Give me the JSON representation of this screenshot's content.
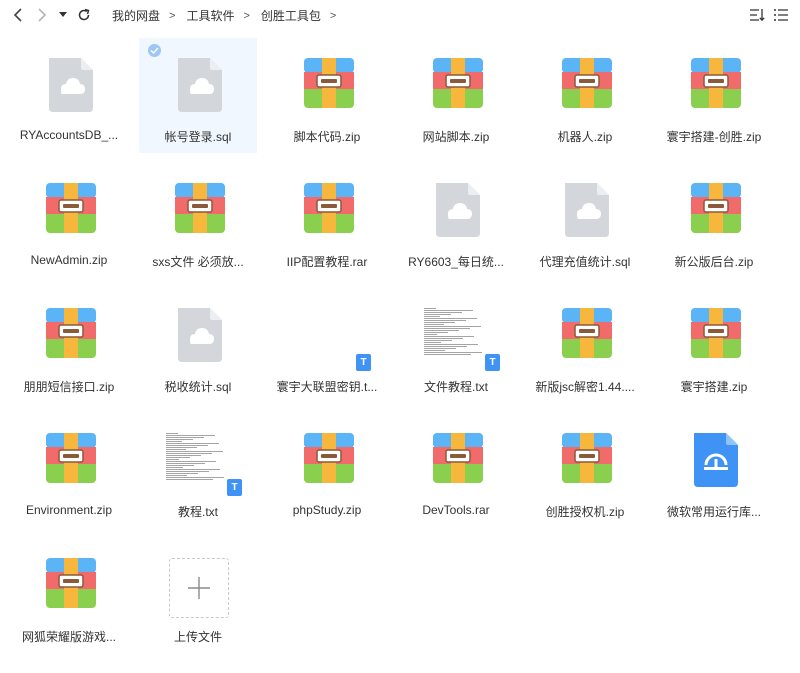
{
  "toolbar": {
    "back_icon": "chevron-left-icon",
    "forward_icon": "chevron-right-icon",
    "history_icon": "caret-down-icon",
    "refresh_icon": "refresh-icon",
    "sort_icon": "sort-icon",
    "list_view_icon": "list-view-icon"
  },
  "breadcrumb": {
    "items": [
      "我的网盘",
      "工具软件",
      "创胜工具包"
    ],
    "separator": ">"
  },
  "files": [
    {
      "name": "RYAccountsDB_...",
      "type": "doc"
    },
    {
      "name": "帐号登录.sql",
      "type": "doc",
      "selected": true
    },
    {
      "name": "脚本代码.zip",
      "type": "zip"
    },
    {
      "name": "网站脚本.zip",
      "type": "zip"
    },
    {
      "name": "机器人.zip",
      "type": "zip"
    },
    {
      "name": "寰宇搭建-创胜.zip",
      "type": "zip"
    },
    {
      "name": "NewAdmin.zip",
      "type": "zip"
    },
    {
      "name": "sxs文件 必须放...",
      "type": "zip"
    },
    {
      "name": "IIP配置教程.rar",
      "type": "zip"
    },
    {
      "name": "RY6603_每日统...",
      "type": "doc"
    },
    {
      "name": "代理充值统计.sql",
      "type": "doc"
    },
    {
      "name": "新公版后台.zip",
      "type": "zip"
    },
    {
      "name": "朋朋短信接口.zip",
      "type": "zip"
    },
    {
      "name": "税收统计.sql",
      "type": "doc"
    },
    {
      "name": "寰宇大联盟密钥.t...",
      "type": "txt-blank"
    },
    {
      "name": "文件教程.txt",
      "type": "txt-preview"
    },
    {
      "name": "新版jsc解密1.44....",
      "type": "zip"
    },
    {
      "name": "寰宇搭建.zip",
      "type": "zip"
    },
    {
      "name": "Environment.zip",
      "type": "zip"
    },
    {
      "name": "教程.txt",
      "type": "txt-preview"
    },
    {
      "name": "phpStudy.zip",
      "type": "zip"
    },
    {
      "name": "DevTools.rar",
      "type": "zip"
    },
    {
      "name": "创胜授权机.zip",
      "type": "zip"
    },
    {
      "name": "微软常用运行库...",
      "type": "installer"
    },
    {
      "name": "网狐荣耀版游戏...",
      "type": "zip"
    }
  ],
  "upload": {
    "label": "上传文件",
    "icon": "plus-icon"
  },
  "colors": {
    "accent": "#3f93f5",
    "selected_bg": "#f0f7ff",
    "zip_blue": "#5ab4f5",
    "zip_red": "#f26b6b",
    "zip_green": "#8bcf4f",
    "zip_yellow": "#f6b73c",
    "doc_gray": "#d3d6db"
  }
}
